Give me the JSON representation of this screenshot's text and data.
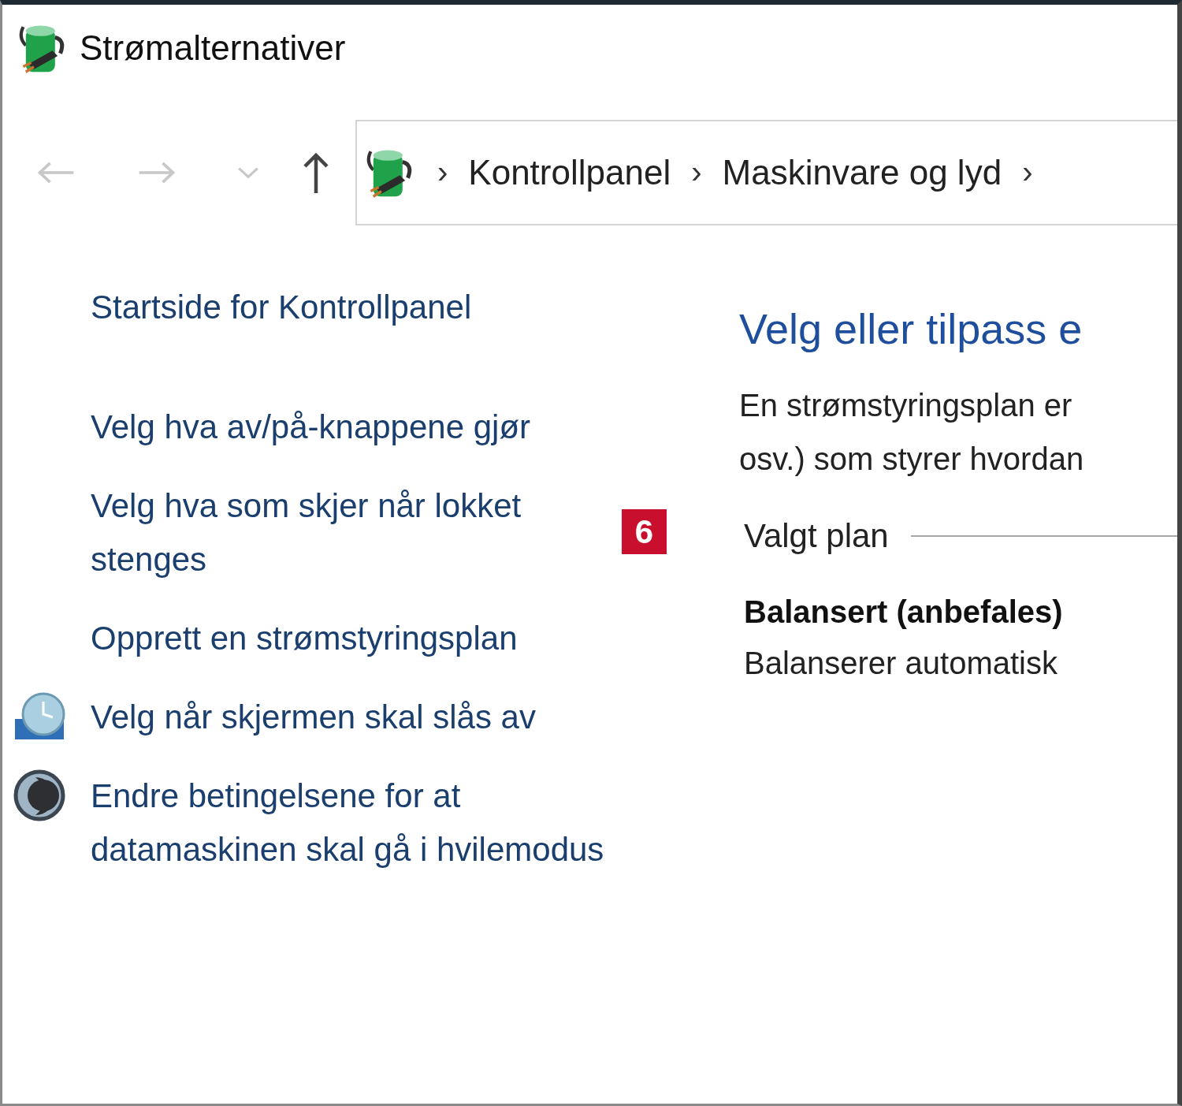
{
  "window": {
    "title": "Strømalternativer"
  },
  "navigation": {
    "back": {
      "disabled": true
    },
    "forward": {
      "disabled": true
    },
    "recent": {
      "disabled": true
    },
    "up": {
      "disabled": false
    }
  },
  "address_bar": {
    "crumbs": [
      "Kontrollpanel",
      "Maskinvare og lyd"
    ],
    "separator": "›"
  },
  "sidebar": {
    "items": [
      {
        "label": "Startside for Kontrollpanel",
        "kind": "home"
      },
      {
        "label": "Velg hva av/på-knappene gjør",
        "kind": "plain"
      },
      {
        "label": "Velg hva som skjer når lokket stenges",
        "kind": "plain",
        "badge": "6"
      },
      {
        "label": "Opprett en strømstyringsplan",
        "kind": "plain"
      },
      {
        "label": "Velg når skjermen skal slås av",
        "kind": "display"
      },
      {
        "label": "Endre betingelsene for at datamaskinen skal gå i hvilemodus",
        "kind": "sleep"
      }
    ]
  },
  "main": {
    "heading": "Velg eller tilpass e",
    "description": [
      "En strømstyringsplan er",
      "osv.) som styrer hvordan"
    ],
    "section": "Valgt plan",
    "plan": {
      "name": "Balansert (anbefales)",
      "description": "Balanserer automatisk"
    }
  }
}
